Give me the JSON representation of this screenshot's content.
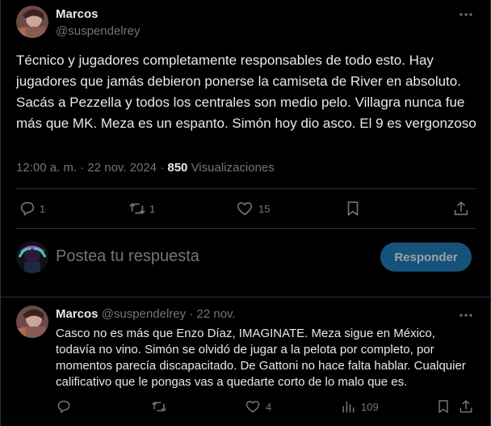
{
  "tweet": {
    "author_name": "Marcos",
    "author_handle": "@suspendelrey",
    "text": "Técnico y jugadores completamente responsables de todo esto. Hay jugadores que jamás debieron ponerse la camiseta de River en absoluto. Sacás a Pezzella y todos los centrales son medio pelo. Villagra nunca fue más que MK. Meza es un espanto. Simón hoy dio asco. El 9 es vergonzoso",
    "time": "12:00 a. m.",
    "date": "22 nov. 2024",
    "views_count": "850",
    "views_label": "Visualizaciones",
    "replies": "1",
    "retweets": "1",
    "likes": "15"
  },
  "composer": {
    "placeholder": "Postea tu respuesta",
    "button_label": "Responder"
  },
  "reply": {
    "author_name": "Marcos",
    "author_handle": "@suspendelrey",
    "date": "22 nov.",
    "text": "Casco no es más que Enzo Díaz, IMAGINATE. Meza sigue en México, todavía no vino. Simón se olvidó de jugar a la pelota por completo, por momentos parecía discapacitado. De Gattoni no hace falta hablar. Cualquier calificativo que le pongas vas a quedarte corto de lo malo que es.",
    "replies": "",
    "retweets": "",
    "likes": "4",
    "views": "109"
  },
  "icons": [
    "more-icon",
    "reply-icon",
    "retweet-icon",
    "like-icon",
    "bookmark-icon",
    "share-icon",
    "views-icon"
  ],
  "colors": {
    "accent": "#1d9bf0",
    "muted": "#71767b",
    "text": "#e7e9ea",
    "divider": "#2f3336"
  }
}
